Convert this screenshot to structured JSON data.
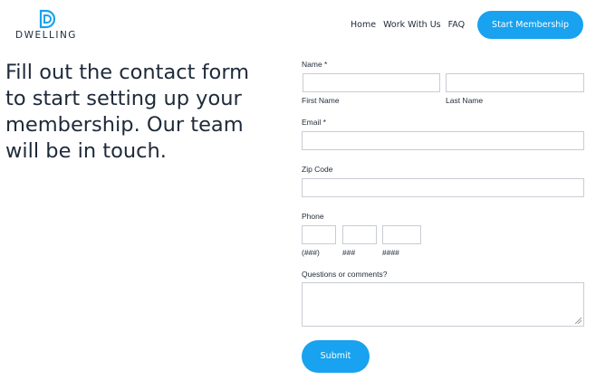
{
  "brand": {
    "name": "DWELLING",
    "accent": "#18a2ef",
    "text_color": "#1e2a3a"
  },
  "nav": {
    "items": [
      "Home",
      "Work With Us",
      "FAQ"
    ],
    "cta": "Start Membership"
  },
  "headline": "Fill out the contact form to start setting up your membership. Our team will be in touch.",
  "form": {
    "name_label": "Name *",
    "first_name_label": "First Name",
    "last_name_label": "Last Name",
    "email_label": "Email *",
    "zip_label": "Zip Code",
    "phone_label": "Phone",
    "phone_area_hint": "(###)",
    "phone_prefix_hint": "###",
    "phone_line_hint": "####",
    "comments_label": "Questions or comments?",
    "submit_label": "Submit"
  }
}
